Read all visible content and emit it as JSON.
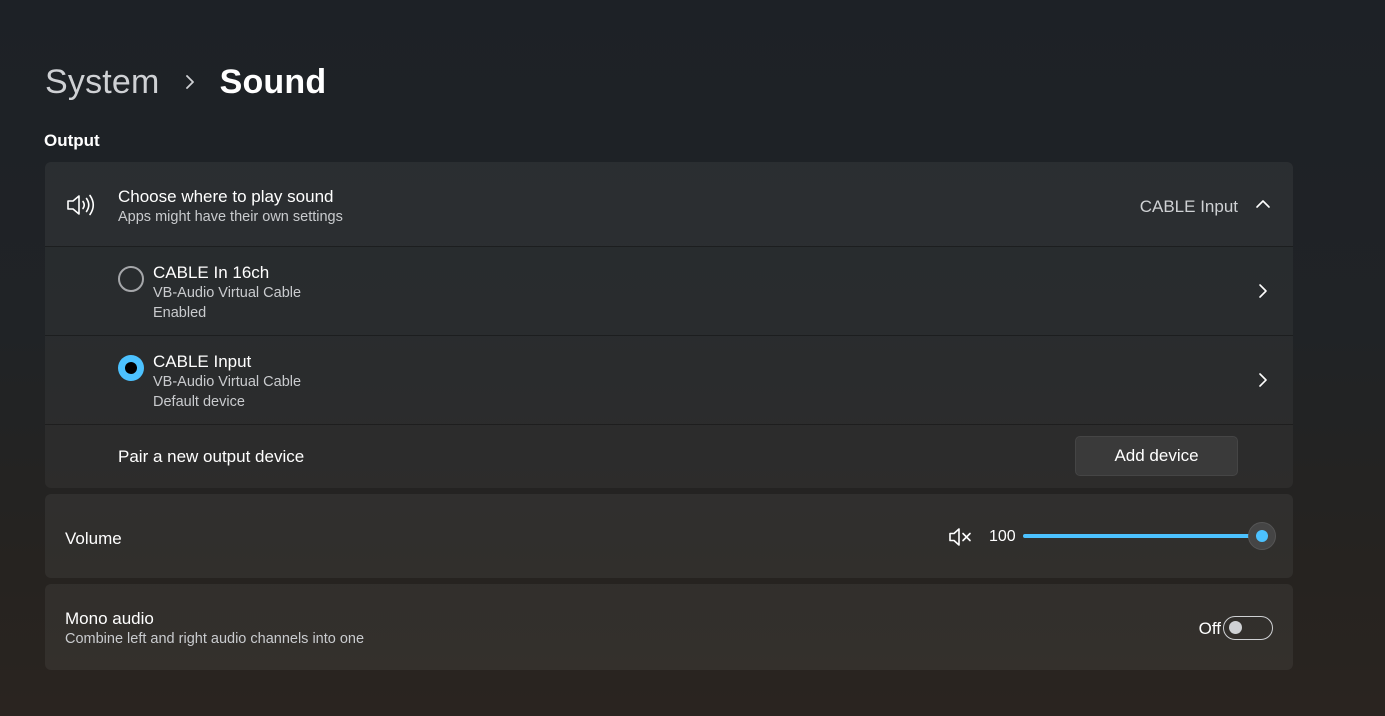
{
  "breadcrumb": {
    "parent": "System",
    "current": "Sound"
  },
  "output": {
    "section_title": "Output",
    "choose": {
      "title": "Choose where to play sound",
      "subtitle": "Apps might have their own settings",
      "selected_value": "CABLE Input",
      "expanded": true
    },
    "devices": [
      {
        "name": "CABLE In 16ch",
        "driver": "VB-Audio Virtual Cable",
        "status": "Enabled",
        "selected": false
      },
      {
        "name": "CABLE Input",
        "driver": "VB-Audio Virtual Cable",
        "status": "Default device",
        "selected": true
      }
    ],
    "pair": {
      "label": "Pair a new output device",
      "button_label": "Add device"
    }
  },
  "volume": {
    "label": "Volume",
    "value": "100",
    "level_percent": 100,
    "icon": "speaker-muted-icon"
  },
  "mono": {
    "title": "Mono audio",
    "subtitle": "Combine left and right audio channels into one",
    "state_label": "Off",
    "on": false
  },
  "colors": {
    "accent": "#4cc2ff",
    "text_primary": "#ffffff",
    "text_secondary": "#c9cbce",
    "card_bg": "#2b2d30",
    "button_bg": "#3a3a3a"
  }
}
